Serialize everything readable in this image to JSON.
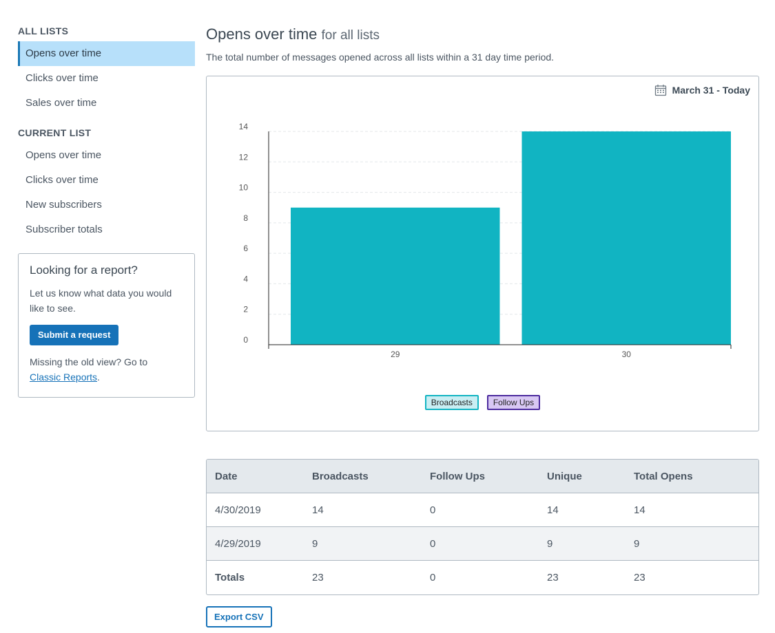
{
  "sidebar": {
    "all_lists_heading": "ALL LISTS",
    "all_lists_items": [
      "Opens over time",
      "Clicks over time",
      "Sales over time"
    ],
    "current_list_heading": "CURRENT LIST",
    "current_list_items": [
      "Opens over time",
      "Clicks over time",
      "New subscribers",
      "Subscriber totals"
    ],
    "active_item": "Opens over time",
    "promo": {
      "title": "Looking for a report?",
      "text": "Let us know what data you would like to see.",
      "button_label": "Submit a request",
      "missing_text": "Missing the old view? Go to",
      "link_text": "Classic Reports",
      "link_suffix": "."
    }
  },
  "main": {
    "title": "Opens over time",
    "title_suffix": "for all lists",
    "description": "The total number of messages opened across all lists within a 31 day time period.",
    "date_range": "March 31 - Today",
    "date_icon": "calendar-icon"
  },
  "chart_data": {
    "type": "bar",
    "categories": [
      "29",
      "30"
    ],
    "series": [
      {
        "name": "Broadcasts",
        "values": [
          9,
          14
        ],
        "color": "#11b4c2"
      },
      {
        "name": "Follow Ups",
        "values": [
          0,
          0
        ],
        "color": "#4b2a9e"
      }
    ],
    "yticks": [
      0,
      2,
      4,
      6,
      8,
      10,
      12,
      14
    ],
    "ylim": [
      0,
      14
    ],
    "grid": true,
    "legend": "bottom-center",
    "title": "",
    "xlabel": "",
    "ylabel": ""
  },
  "table": {
    "headers": [
      "Date",
      "Broadcasts",
      "Follow Ups",
      "Unique",
      "Total Opens"
    ],
    "rows": [
      [
        "4/30/2019",
        "14",
        "0",
        "14",
        "14"
      ],
      [
        "4/29/2019",
        "9",
        "0",
        "9",
        "9"
      ]
    ],
    "totals": [
      "Totals",
      "23",
      "0",
      "23",
      "23"
    ]
  },
  "export_label": "Export CSV",
  "colors": {
    "accent": "#1672b8",
    "active_nav_bg": "#b7e0fa",
    "broadcasts": "#11b4c2",
    "follow_ups": "#4b2a9e"
  }
}
